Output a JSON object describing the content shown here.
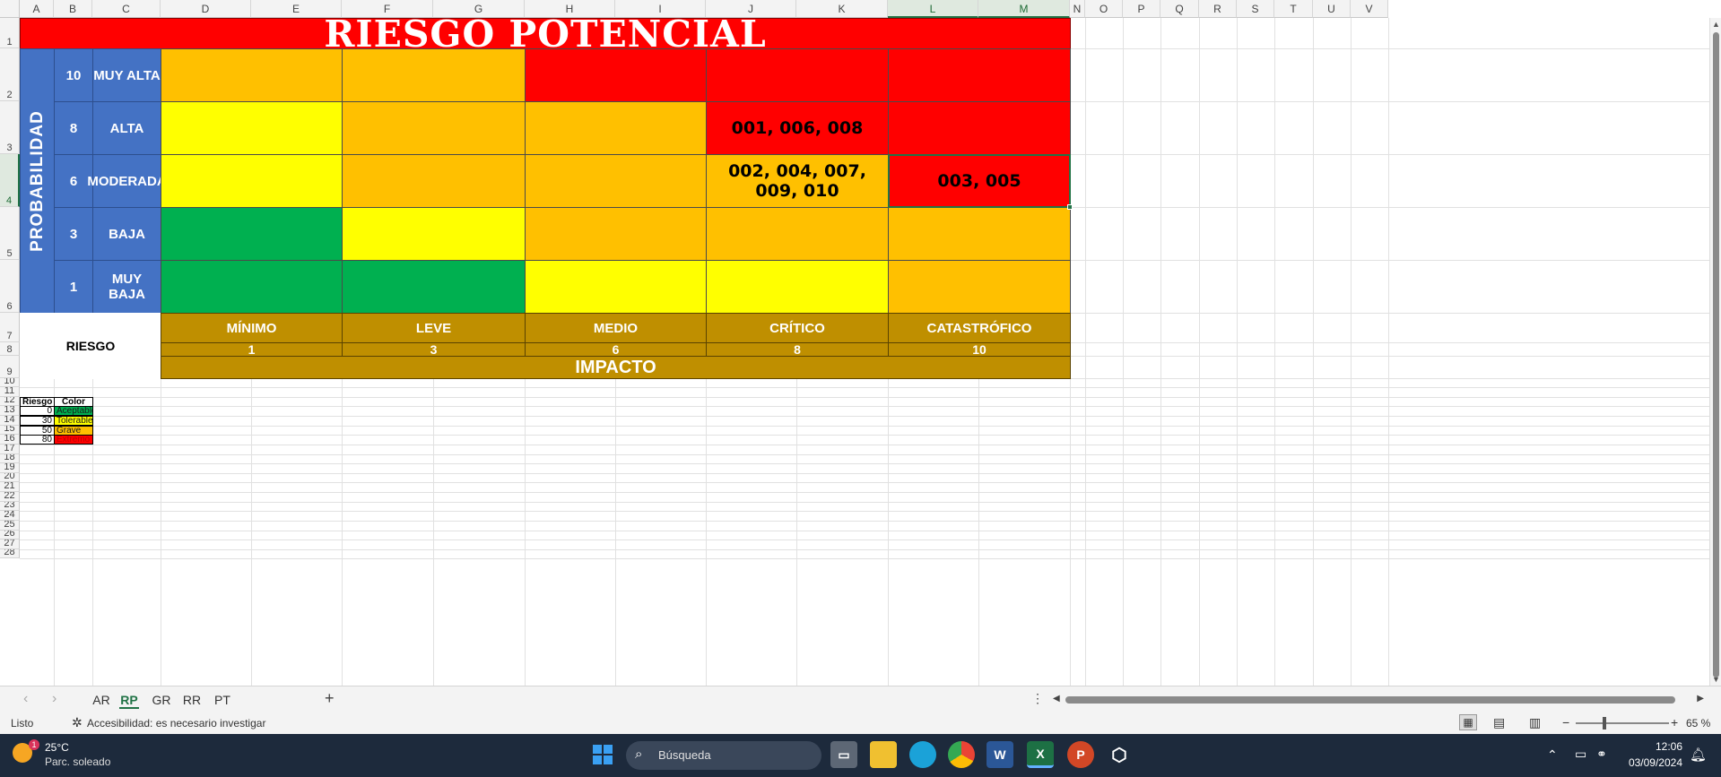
{
  "columns": [
    "A",
    "B",
    "C",
    "D",
    "E",
    "F",
    "G",
    "H",
    "I",
    "J",
    "K",
    "L",
    "M",
    "N",
    "O",
    "P",
    "Q",
    "R",
    "S",
    "T",
    "U",
    "V"
  ],
  "rows": [
    "1",
    "2",
    "3",
    "4",
    "5",
    "6",
    "7",
    "8",
    "9",
    "10",
    "11",
    "12",
    "13",
    "14",
    "15",
    "16",
    "17",
    "18",
    "19",
    "20",
    "21",
    "22",
    "23",
    "24",
    "25",
    "26",
    "27",
    "28"
  ],
  "title": "RIESGO POTENCIAL",
  "axis_y": "PROBABILIDAD",
  "axis_x": "IMPACTO",
  "corner_label": "RIESGO",
  "probabilities": [
    {
      "value": "10",
      "label": "MUY ALTA"
    },
    {
      "value": "8",
      "label": "ALTA"
    },
    {
      "value": "6",
      "label": "MODERADA"
    },
    {
      "value": "3",
      "label": "BAJA"
    },
    {
      "value": "1",
      "label": "MUY BAJA"
    }
  ],
  "impacts": [
    {
      "label": "MÍNIMO",
      "value": "1"
    },
    {
      "label": "LEVE",
      "value": "3"
    },
    {
      "label": "MEDIO",
      "value": "6"
    },
    {
      "label": "CRÍTICO",
      "value": "8"
    },
    {
      "label": "CATASTRÓFICO",
      "value": "10"
    }
  ],
  "matrix_colors": [
    [
      "#ffc000",
      "#ffc000",
      "#ff0000",
      "#ff0000",
      "#ff0000"
    ],
    [
      "#ffff00",
      "#ffc000",
      "#ffc000",
      "#ff0000",
      "#ff0000"
    ],
    [
      "#ffff00",
      "#ffc000",
      "#ffc000",
      "#ffc000",
      "#ff0000"
    ],
    [
      "#00b050",
      "#ffff00",
      "#ffc000",
      "#ffc000",
      "#ffc000"
    ],
    [
      "#00b050",
      "#00b050",
      "#ffff00",
      "#ffff00",
      "#ffc000"
    ]
  ],
  "matrix_values": [
    [
      "",
      "",
      "",
      "",
      ""
    ],
    [
      "",
      "",
      "",
      "001, 006, 008",
      ""
    ],
    [
      "",
      "",
      "",
      "002, 004, 007, 009, 010",
      "003, 005"
    ],
    [
      "",
      "",
      "",
      "",
      ""
    ],
    [
      "",
      "",
      "",
      "",
      ""
    ]
  ],
  "legend": {
    "header_riesgo": "Riesgo",
    "header_color": "Color",
    "items": [
      {
        "riesgo": "0",
        "label": "Aceptable",
        "color": "#00b050",
        "text": "#1a1a1a"
      },
      {
        "riesgo": "30",
        "label": "Tolerable",
        "color": "#ffff00",
        "text": "#1a1a1a"
      },
      {
        "riesgo": "50",
        "label": "Grave",
        "color": "#ffc000",
        "text": "#1a1a1a"
      },
      {
        "riesgo": "80",
        "label": "Extremo",
        "color": "#ff0000",
        "text": "#c00000"
      }
    ]
  },
  "sheets": [
    {
      "name": "AR",
      "active": false
    },
    {
      "name": "RP",
      "active": true
    },
    {
      "name": "GR",
      "active": false
    },
    {
      "name": "RR",
      "active": false
    },
    {
      "name": "PT",
      "active": false
    }
  ],
  "add_sheet": "+",
  "status": {
    "mode": "Listo",
    "accessibility": "Accesibilidad: es necesario investigar",
    "zoom": "65 %"
  },
  "taskbar": {
    "weather_temp": "25°C",
    "weather_desc": "Parc. soleado",
    "weather_badge": "1",
    "search_placeholder": "Búsqueda",
    "time": "12:06",
    "date": "03/09/2024"
  }
}
